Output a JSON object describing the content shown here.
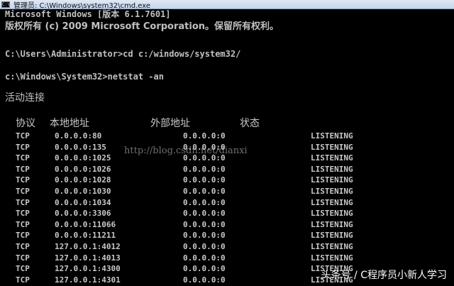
{
  "window": {
    "title": "管理员: C:\\Windows\\system32\\cmd.exe",
    "icon": "cmd-icon"
  },
  "console": {
    "lines": [
      "Microsoft Windows [版本 6.1.7601]",
      "版权所有 (c) 2009 Microsoft Corporation。保留所有权利。",
      "C:\\Users\\Administrator>cd c:/windows/system32/",
      "c:\\Windows\\System32>netstat -an",
      "活动连接"
    ],
    "headers": [
      "协议",
      "本地地址",
      "外部地址",
      "状态"
    ],
    "rows": [
      [
        "TCP",
        "0.0.0.0:80",
        "0.0.0.0:0",
        "LISTENING"
      ],
      [
        "TCP",
        "0.0.0.0:135",
        "0.0.0.0:0",
        "LISTENING"
      ],
      [
        "TCP",
        "0.0.0.0:1025",
        "0.0.0.0:0",
        "LISTENING"
      ],
      [
        "TCP",
        "0.0.0.0:1026",
        "0.0.0.0:0",
        "LISTENING"
      ],
      [
        "TCP",
        "0.0.0.0:1028",
        "0.0.0.0:0",
        "LISTENING"
      ],
      [
        "TCP",
        "0.0.0.0:1030",
        "0.0.0.0:0",
        "LISTENING"
      ],
      [
        "TCP",
        "0.0.0.0:1034",
        "0.0.0.0:0",
        "LISTENING"
      ],
      [
        "TCP",
        "0.0.0.0:3306",
        "0.0.0.0:0",
        "LISTENING"
      ],
      [
        "TCP",
        "0.0.0.0:11066",
        "0.0.0.0:0",
        "LISTENING"
      ],
      [
        "TCP",
        "0.0.0.0:11211",
        "0.0.0.0:0",
        "LISTENING"
      ],
      [
        "TCP",
        "127.0.0.1:4012",
        "0.0.0.0:0",
        "LISTENING"
      ],
      [
        "TCP",
        "127.0.0.1:4013",
        "0.0.0.0:0",
        "LISTENING"
      ],
      [
        "TCP",
        "127.0.0.1:4300",
        "0.0.0.0:0",
        "LISTENING"
      ],
      [
        "TCP",
        "127.0.0.1:4301",
        "0.0.0.0:0",
        "LISTENING"
      ]
    ],
    "partial_glyph": "米"
  },
  "watermark_text": "http://blog.csdn.net/dianxi",
  "overlay_caption": "头条号 / C程序员小新人学习",
  "colors": {
    "console_bg": "#000000",
    "console_fg": "#c0c0c0",
    "titlebar": "#d3e0f0"
  }
}
